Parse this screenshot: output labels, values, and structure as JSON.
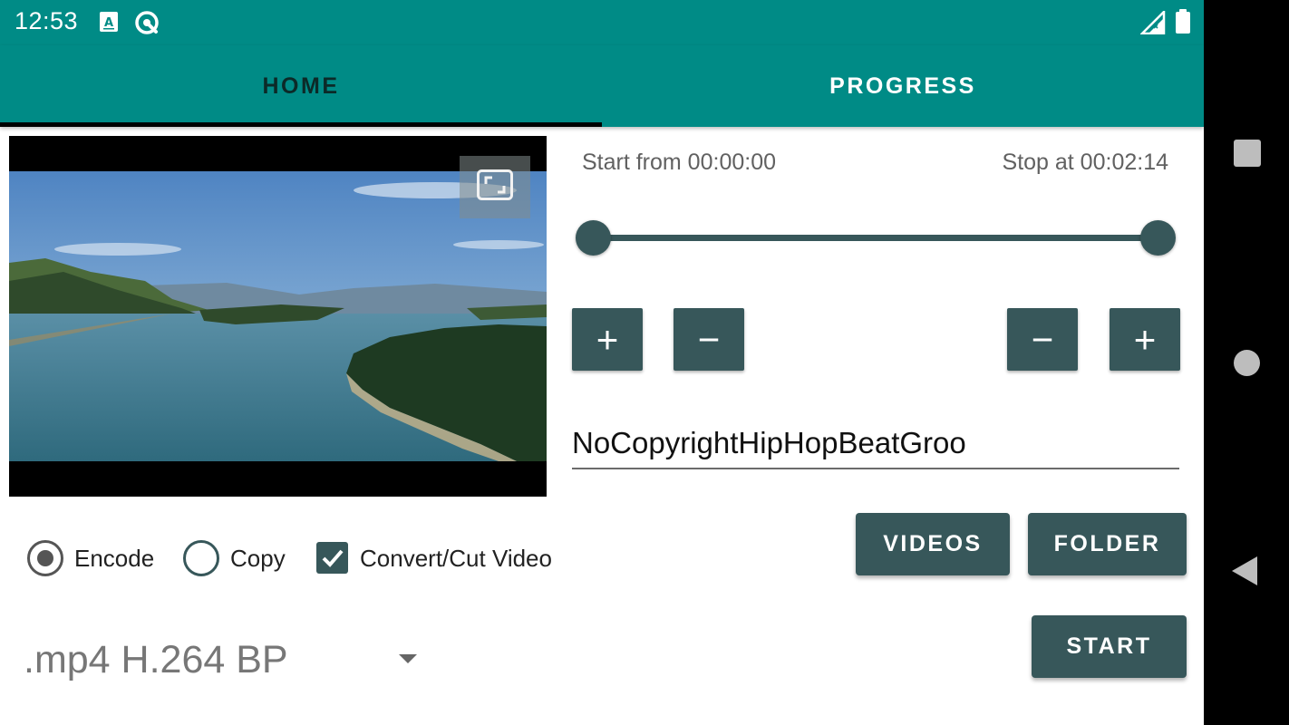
{
  "status_bar": {
    "time": "12:53",
    "icons": [
      "text-a-notification-icon",
      "sync-notification-icon",
      "cell-signal-icon",
      "battery-icon"
    ]
  },
  "tabs": [
    {
      "label": "HOME",
      "selected": true
    },
    {
      "label": "PROGRESS",
      "selected": false
    }
  ],
  "video": {
    "fullscreen_icon": "fullscreen-icon"
  },
  "trim": {
    "start_label": "Start from 00:00:00",
    "stop_label": "Stop at 00:02:14",
    "range_fraction": [
      0,
      1
    ]
  },
  "steppers": {
    "start_plus": "+",
    "start_minus": "−",
    "stop_minus": "−",
    "stop_plus": "+"
  },
  "filename_value": "NoCopyrightHipHopBeatGroo",
  "options": {
    "encode_label": "Encode",
    "encode_selected": true,
    "copy_label": "Copy",
    "copy_selected": false,
    "convert_label": "Convert/Cut Video",
    "convert_checked": true
  },
  "buttons": {
    "videos": "VIDEOS",
    "folder": "FOLDER",
    "start": "START"
  },
  "format": {
    "selected": ".mp4 H.264 BP"
  },
  "colors": {
    "app_bar": "#008b86",
    "accent": "#37575a",
    "tab_selected_text": "#0c2a28"
  }
}
